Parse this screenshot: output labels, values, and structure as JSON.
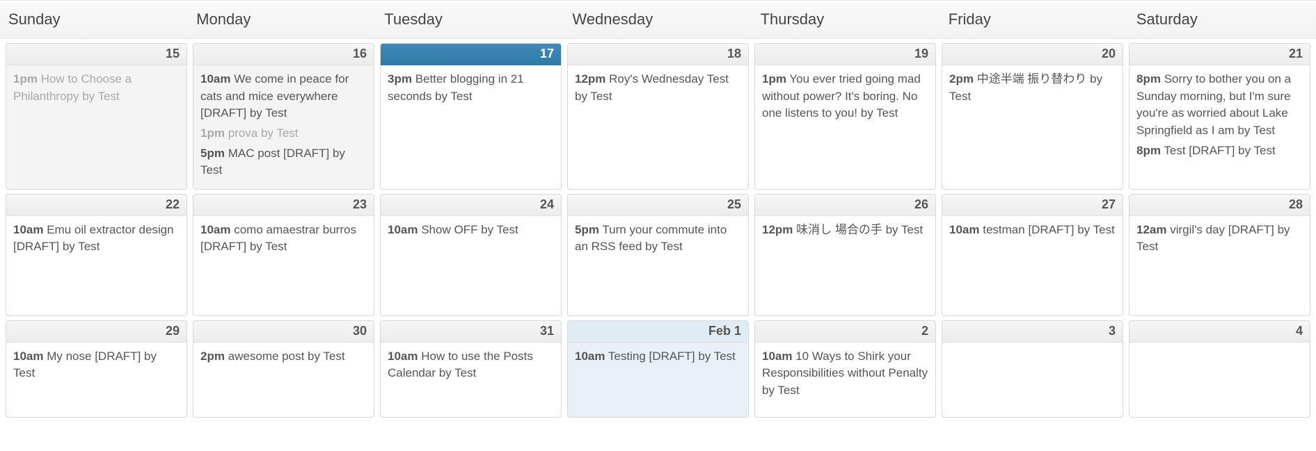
{
  "dayHeaders": [
    "Sunday",
    "Monday",
    "Tuesday",
    "Wednesday",
    "Thursday",
    "Friday",
    "Saturday"
  ],
  "weeks": [
    {
      "class": "first-week",
      "days": [
        {
          "date": "15",
          "past": true,
          "events": [
            {
              "time": "1pm",
              "title": "How to Choose a Philanthropy by Test",
              "dim": true
            }
          ]
        },
        {
          "date": "16",
          "past": true,
          "events": [
            {
              "time": "10am",
              "title": "We come in peace for cats and mice everywhere [DRAFT] by Test"
            },
            {
              "time": "1pm",
              "title": "prova by Test",
              "dim": true
            },
            {
              "time": "5pm",
              "title": "MAC post [DRAFT] by Test"
            }
          ]
        },
        {
          "date": "17",
          "today": true,
          "events": [
            {
              "time": "3pm",
              "title": "Better blogging in 21 seconds by Test"
            }
          ]
        },
        {
          "date": "18",
          "events": [
            {
              "time": "12pm",
              "title": "Roy's Wednesday Test by Test"
            }
          ]
        },
        {
          "date": "19",
          "events": [
            {
              "time": "1pm",
              "title": "You ever tried going mad without power? It's boring. No one listens to you! by Test"
            }
          ]
        },
        {
          "date": "20",
          "events": [
            {
              "time": "2pm",
              "title": "中途半端 振り替わり by Test"
            }
          ]
        },
        {
          "date": "21",
          "events": [
            {
              "time": "8pm",
              "title": "Sorry to bother you on a Sunday morning, but I'm sure you're as worried about Lake Springfield as I am by Test"
            },
            {
              "time": "8pm",
              "title": "Test [DRAFT] by Test"
            }
          ]
        }
      ]
    },
    {
      "class": "mid-week",
      "days": [
        {
          "date": "22",
          "events": [
            {
              "time": "10am",
              "title": "Emu oil extractor design [DRAFT] by Test"
            }
          ]
        },
        {
          "date": "23",
          "events": [
            {
              "time": "10am",
              "title": "como amaestrar burros [DRAFT] by Test"
            }
          ]
        },
        {
          "date": "24",
          "events": [
            {
              "time": "10am",
              "title": "Show OFF by Test"
            }
          ]
        },
        {
          "date": "25",
          "events": [
            {
              "time": "5pm",
              "title": "Turn your commute into an RSS feed by Test"
            }
          ]
        },
        {
          "date": "26",
          "events": [
            {
              "time": "12pm",
              "title": "味消し 場合の手 by Test"
            }
          ]
        },
        {
          "date": "27",
          "events": [
            {
              "time": "10am",
              "title": "testman [DRAFT] by Test"
            }
          ]
        },
        {
          "date": "28",
          "events": [
            {
              "time": "12am",
              "title": "virgil's day [DRAFT] by Test"
            }
          ]
        }
      ]
    },
    {
      "class": "last-week",
      "days": [
        {
          "date": "29",
          "events": [
            {
              "time": "10am",
              "title": "My nose [DRAFT] by Test"
            }
          ]
        },
        {
          "date": "30",
          "events": [
            {
              "time": "2pm",
              "title": "awesome post by Test"
            }
          ]
        },
        {
          "date": "31",
          "events": [
            {
              "time": "10am",
              "title": "How to use the Posts Calendar by Test"
            }
          ]
        },
        {
          "date": "Feb 1",
          "todayMarked": true,
          "events": [
            {
              "time": "10am",
              "title": "Testing [DRAFT] by Test"
            }
          ]
        },
        {
          "date": "2",
          "events": [
            {
              "time": "10am",
              "title": "10 Ways to Shirk your Responsibilities without Penalty by Test"
            }
          ]
        },
        {
          "date": "3",
          "events": []
        },
        {
          "date": "4",
          "events": []
        }
      ]
    }
  ]
}
